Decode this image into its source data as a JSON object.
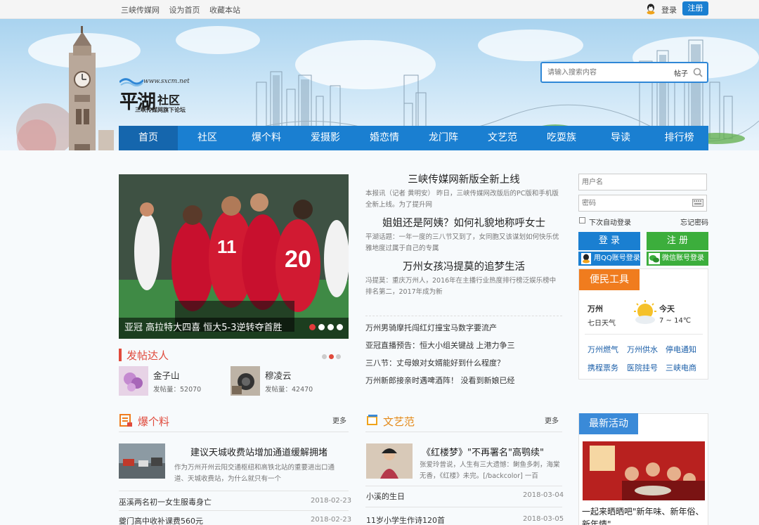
{
  "topbar": {
    "links": [
      "三峡传媒网",
      "设为首页",
      "收藏本站"
    ],
    "login": "登录",
    "register": "注册"
  },
  "logo": {
    "url": "www.sxcm.net",
    "name_big": "平湖",
    "name_small": "社区",
    "subtitle": "三峡传媒网旗下论坛"
  },
  "search": {
    "placeholder": "请输入搜索内容",
    "type": "帖子"
  },
  "nav": {
    "items": [
      "首页",
      "社区",
      "爆个料",
      "爱摄影",
      "婚恋情",
      "龙门阵",
      "文艺范",
      "吃耍族",
      "导读",
      "排行榜"
    ],
    "active": 0
  },
  "slider": {
    "caption": "亚冠 高拉特大四喜 恒大5-3逆转夺首胜",
    "dots": 4,
    "active_dot": 0
  },
  "news": {
    "headlines": [
      {
        "title": "三峡传媒网新版全新上线",
        "summary": "本报讯（记者 黄明安） 昨日，三峡传媒网改版后的PC版和手机版全新上线。为了提升网"
      },
      {
        "title": "姐姐还是阿姨？如何礼貌地称呼女士",
        "summary": "平湖话题：一年一度的三八节又到了，女同胞又该谋划如何快乐优雅地度过属于自己的专属"
      },
      {
        "title": "万州女孩冯提莫的追梦生活",
        "summary": "冯提莫：重庆万州人，2016年在主播行业热度排行榜泛娱乐榜中排名第二，2017年成为新"
      }
    ],
    "list": [
      "万州男骑摩托闯红灯撞宝马数字要流产",
      "亚冠直播预告：恒大小组关键战 上港力争三",
      "三八节：丈母娘对女婿能好到什么程度？",
      "万州新郎接亲时遇啤酒阵！ 没看到新娘已经"
    ]
  },
  "posters": {
    "title": "发帖达人",
    "users": [
      {
        "name": "金子山",
        "count": "发帖量：52070"
      },
      {
        "name": "穆凌云",
        "count": "发帖量：42470"
      }
    ],
    "dots": 3,
    "active_dot": 1
  },
  "login_box": {
    "username_placeholder": "用户名",
    "password_placeholder": "密码",
    "auto_login": "下次自动登录",
    "forgot": "忘记密码",
    "login": "登 录",
    "register": "注 册",
    "qq_login": "用QQ账号登录",
    "wechat_login": "微信账号登录"
  },
  "tools": {
    "tab": "便民工具",
    "city": "万州",
    "forecast": "七日天气",
    "today": "今天",
    "temp": "7 ~ 14℃",
    "links": [
      "万州燃气",
      "万州供水",
      "停电通知",
      "携程票务",
      "医院挂号",
      "三峡电商"
    ]
  },
  "baoliao": {
    "title": "爆个料",
    "more": "更多",
    "feature_title": "建议天城收费站增加通道缓解拥堵",
    "feature_desc": "作为万州开州云阳交通枢纽和高铁北站的重要进出口通道、天城收费站，为什么就只有一个",
    "rows": [
      {
        "title": "巫溪两名初一女生服毒身亡",
        "date": "2018-02-23"
      },
      {
        "title": "夔门高中收补课费560元",
        "date": "2018-02-23"
      }
    ]
  },
  "wenyi": {
    "title": "文艺范",
    "more": "更多",
    "feature_title": "《红楼梦》\"不再署名\"高鹗续\"",
    "feature_desc": "张爱玲曾说，人生有三大遗憾：鲥鱼多刺，海棠无香，《红楼》未完。[/backcolor] 一百",
    "rows": [
      {
        "title": "小溪的生日",
        "date": "2018-03-04"
      },
      {
        "title": "11岁小学生作诗120首",
        "date": "2018-03-05"
      }
    ]
  },
  "activity": {
    "tab": "最新活动",
    "caption": "一起来晒晒吧\"新年味、新年俗、新年情\""
  }
}
